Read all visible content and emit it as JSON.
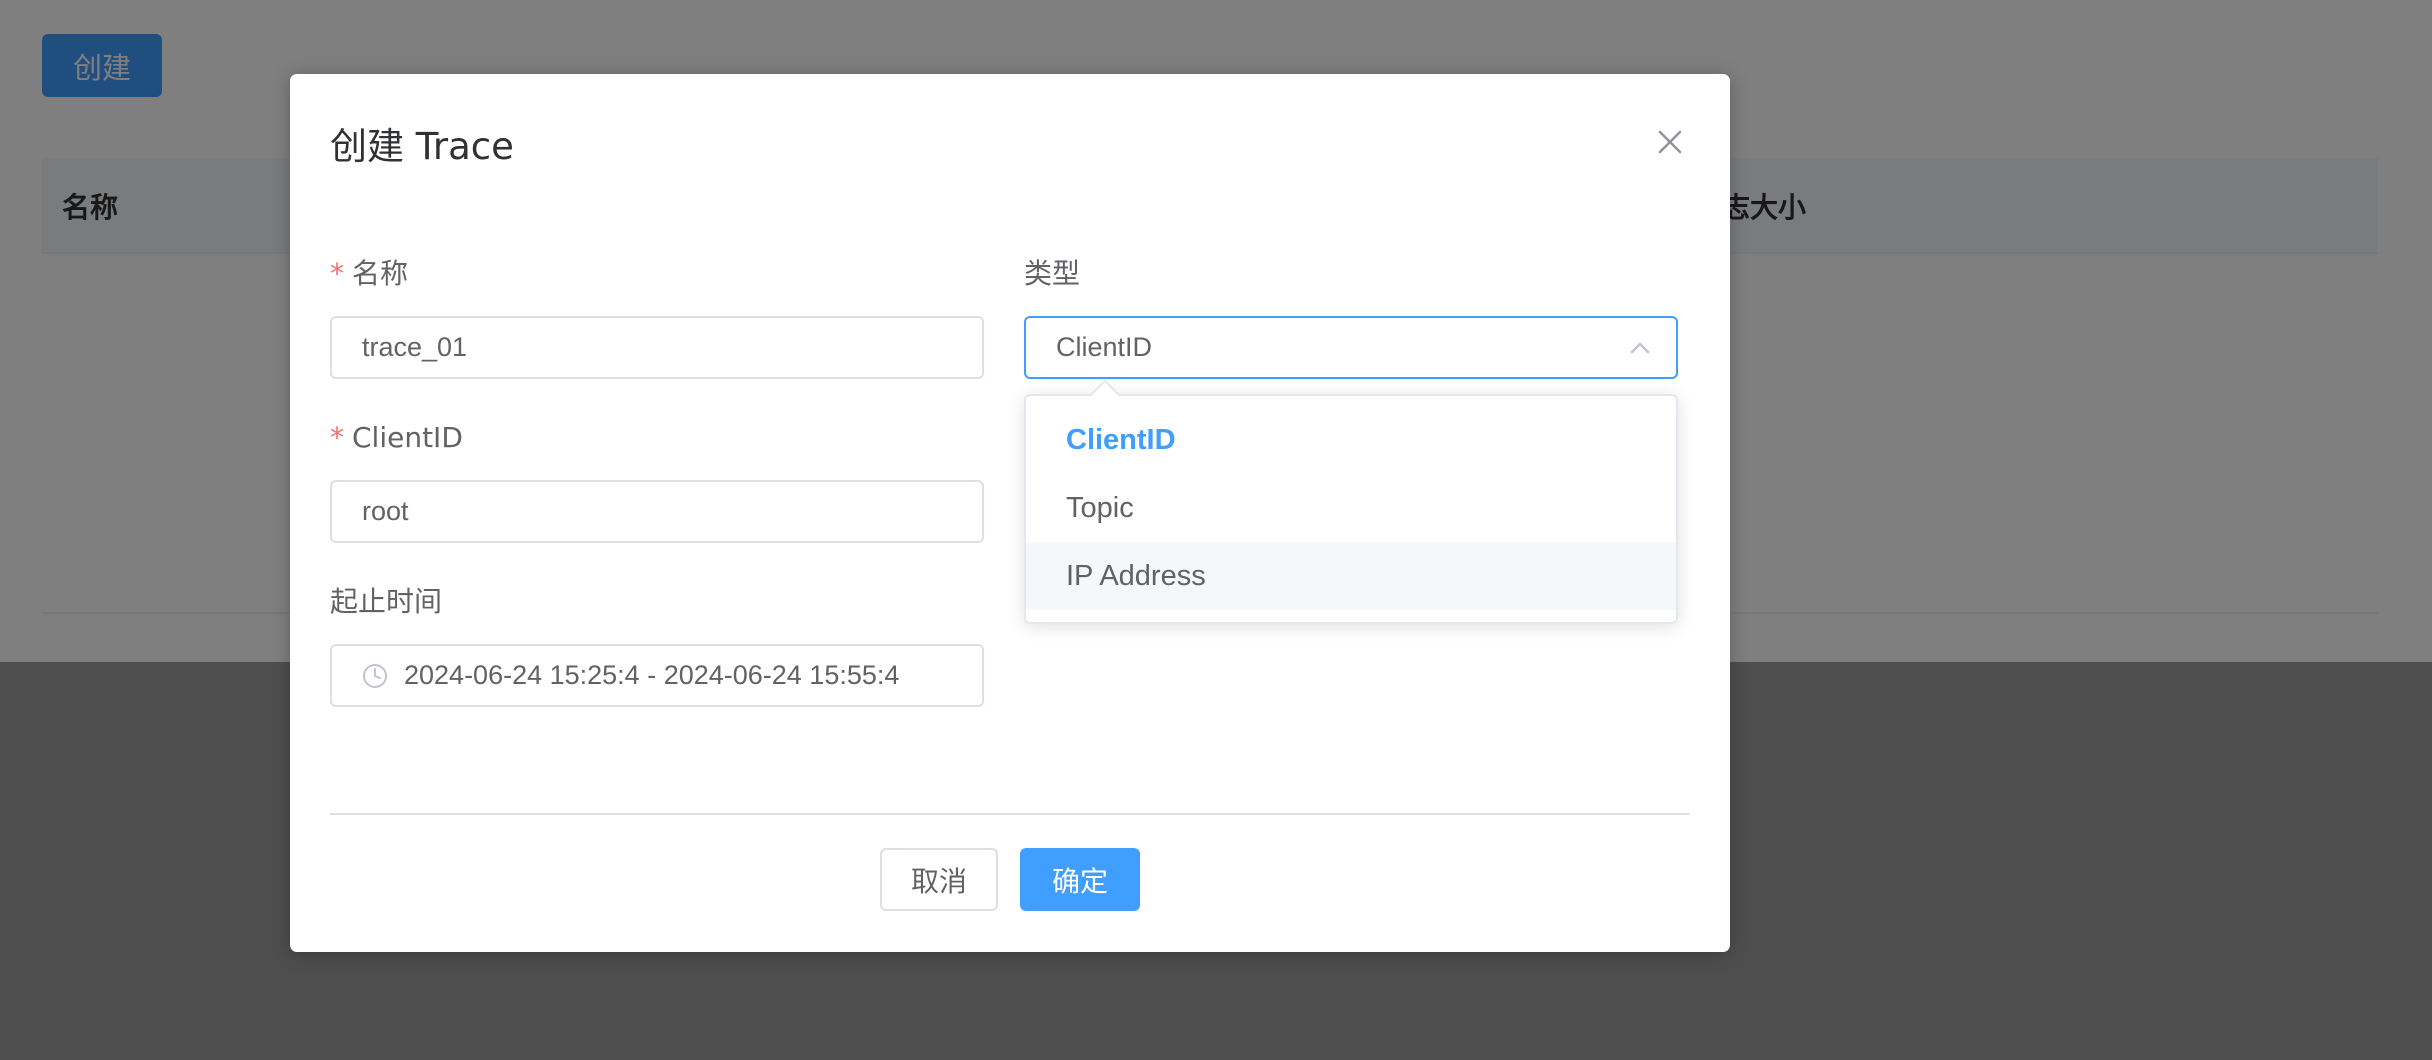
{
  "background": {
    "create_button_label": "创建",
    "table_headers": [
      "名称",
      "志大小"
    ]
  },
  "dialog": {
    "title": "创建 Trace",
    "form": {
      "name": {
        "label": "名称",
        "required_mark": "*",
        "value": "trace_01"
      },
      "type": {
        "label": "类型",
        "value": "ClientID",
        "options": [
          "ClientID",
          "Topic",
          "IP Address"
        ],
        "selected_option": "ClientID",
        "hovered_option": "IP Address"
      },
      "client_id": {
        "label": "ClientID",
        "required_mark": "*",
        "value": "root"
      },
      "time_range": {
        "label": "起止时间",
        "value": "2024-06-24 15:25:4 - 2024-06-24 15:55:4"
      }
    },
    "cancel_label": "取消",
    "confirm_label": "确定"
  },
  "colors": {
    "primary": "#409eff",
    "required": "#f56c6c",
    "text": "#606266",
    "border": "#dcdfe6"
  },
  "icons": {
    "close": "close-icon",
    "select_arrow": "chevron-up-icon",
    "date": "clock-icon"
  }
}
